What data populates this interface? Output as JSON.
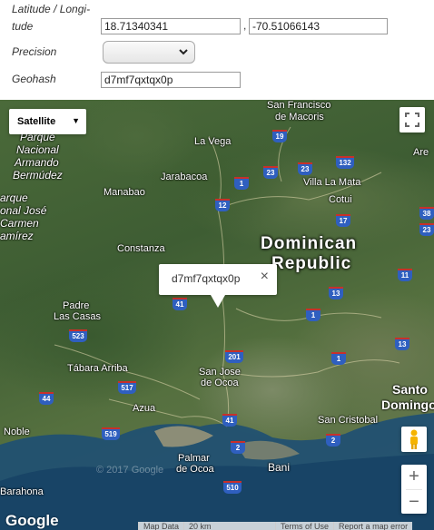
{
  "form": {
    "latlon_label": "Latitude / Longi-tude",
    "latlon_label_line1": "Latitude / Longi-",
    "latlon_label_line2": "tude",
    "latitude_value": "18.71340341",
    "separator": ",",
    "longitude_value": "-70.51066143",
    "precision_label": "Precision",
    "precision_value": "",
    "geohash_label": "Geohash",
    "geohash_value": "d7mf7qxtqx0p"
  },
  "map": {
    "map_type_label": "Satellite",
    "country_line1": "Dominican",
    "country_line2": "Republic",
    "info_window_text": "d7mf7qxtqx0p",
    "copyright_faint": "© 2017 Google",
    "google_logo": "Google",
    "footer": {
      "map_data": "Map Data",
      "scale": "20 km",
      "terms": "Terms of Use",
      "report": "Report a map error"
    },
    "zoom_in": "+",
    "zoom_out": "−",
    "places": [
      {
        "id": "san-francisco",
        "text": "San Francisco"
      },
      {
        "id": "de-macoris",
        "text": "de Macoris"
      },
      {
        "id": "are",
        "text": "Are"
      },
      {
        "id": "parque",
        "text": "Parque"
      },
      {
        "id": "nacional",
        "text": "Nacional"
      },
      {
        "id": "armando",
        "text": "Armando"
      },
      {
        "id": "bermudez",
        "text": "Bermúdez"
      },
      {
        "id": "la-vega",
        "text": "La Vega"
      },
      {
        "id": "jarabacoa",
        "text": "Jarabacoa"
      },
      {
        "id": "villa-la-mata",
        "text": "Villa La Mata"
      },
      {
        "id": "manabao",
        "text": "Manabao"
      },
      {
        "id": "cotui",
        "text": "Cotui"
      },
      {
        "id": "arque",
        "text": "arque"
      },
      {
        "id": "nal-jose",
        "text": "onal José"
      },
      {
        "id": "carmen",
        "text": "Carmen"
      },
      {
        "id": "ramirez",
        "text": "amírez"
      },
      {
        "id": "constanza",
        "text": "Constanza"
      },
      {
        "id": "padre",
        "text": "Padre"
      },
      {
        "id": "las-casas",
        "text": "Las Casas"
      },
      {
        "id": "tabara-arriba",
        "text": "Tábara Arriba"
      },
      {
        "id": "san-jose",
        "text": "San Jose"
      },
      {
        "id": "de-ocoa",
        "text": "de Ocoa"
      },
      {
        "id": "santo",
        "text": "Santo"
      },
      {
        "id": "domingo",
        "text": "Domingo"
      },
      {
        "id": "azua",
        "text": "Azua"
      },
      {
        "id": "noble",
        "text": "Noble"
      },
      {
        "id": "san-cristobal",
        "text": "San Cristobal"
      },
      {
        "id": "palmar",
        "text": "Palmar"
      },
      {
        "id": "palmar-de-ocoa",
        "text": "de Ocoa"
      },
      {
        "id": "bani",
        "text": "Bani"
      },
      {
        "id": "barahona",
        "text": "Barahona"
      }
    ],
    "shields": [
      "19",
      "23",
      "23",
      "132",
      "1",
      "12",
      "17",
      "38",
      "23",
      "11",
      "13",
      "1",
      "41",
      "201",
      "1",
      "13",
      "523",
      "517",
      "44",
      "41",
      "519",
      "2",
      "2",
      "510"
    ]
  }
}
